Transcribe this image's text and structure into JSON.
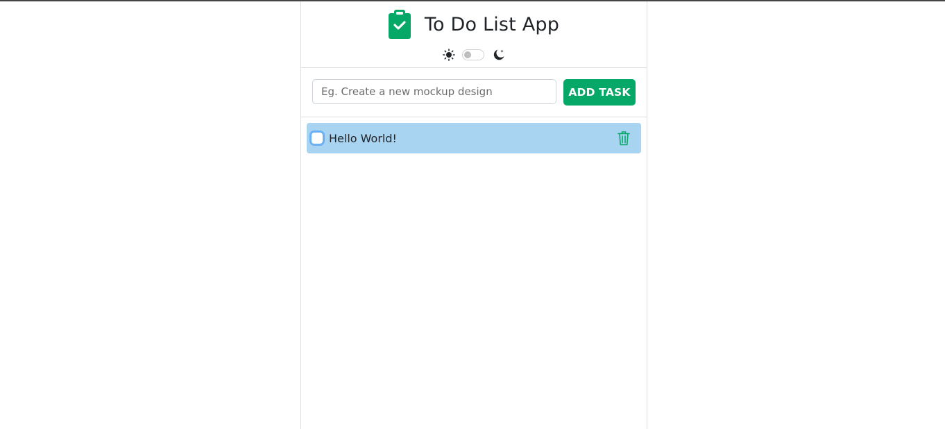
{
  "app": {
    "title": "To Do List App",
    "icon": "clipboard-check-icon"
  },
  "theme": {
    "light_icon": "sun-icon",
    "dark_icon": "moon-icon",
    "dark_mode_enabled": false
  },
  "form": {
    "input_value": "",
    "input_placeholder": "Eg. Create a new mockup design",
    "add_button_label": "ADD TASK"
  },
  "tasks": [
    {
      "text": "Hello World!",
      "completed": false,
      "delete_icon": "trash-icon"
    }
  ],
  "colors": {
    "accent": "#05a867",
    "task_background": "#a8d4f2",
    "checkbox_focus": "#6ab0f3"
  }
}
